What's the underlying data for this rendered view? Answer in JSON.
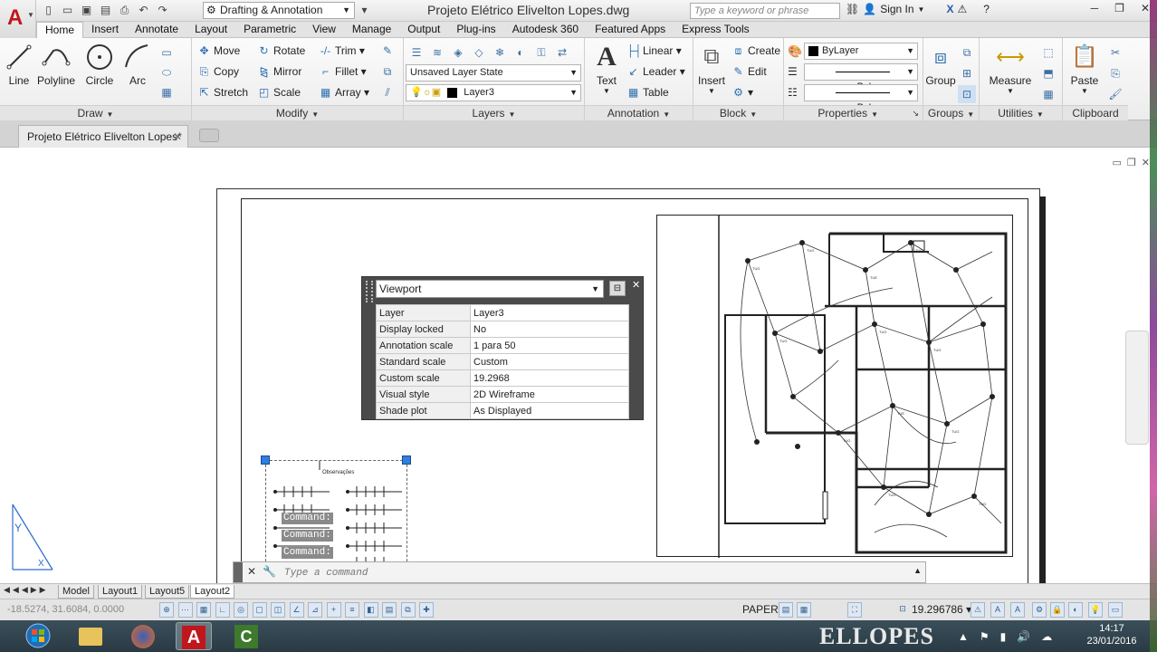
{
  "window": {
    "title": "Projeto Elétrico Elivelton Lopes.dwg",
    "workspace": "Drafting & Annotation",
    "search_placeholder": "Type a keyword or phrase",
    "sign_in": "Sign In"
  },
  "ribbon_tabs": [
    "Home",
    "Insert",
    "Annotate",
    "Layout",
    "Parametric",
    "View",
    "Manage",
    "Output",
    "Plug-ins",
    "Autodesk 360",
    "Featured Apps",
    "Express Tools"
  ],
  "panels": {
    "draw": {
      "title": "Draw",
      "line": "Line",
      "polyline": "Polyline",
      "circle": "Circle",
      "arc": "Arc"
    },
    "modify": {
      "title": "Modify",
      "move": "Move",
      "rotate": "Rotate",
      "trim": "Trim",
      "copy": "Copy",
      "mirror": "Mirror",
      "fillet": "Fillet",
      "stretch": "Stretch",
      "scale": "Scale",
      "array": "Array"
    },
    "layers": {
      "title": "Layers",
      "layer_state": "Unsaved Layer State",
      "current_layer": "Layer3"
    },
    "annotation": {
      "title": "Annotation",
      "text": "Text",
      "linear": "Linear",
      "leader": "Leader",
      "table": "Table"
    },
    "block": {
      "title": "Block",
      "insert": "Insert",
      "create": "Create",
      "edit": "Edit"
    },
    "properties": {
      "title": "Properties",
      "color": "ByLayer",
      "linetype": "ByLayer",
      "lineweight": "ByLayer"
    },
    "groups": {
      "title": "Groups",
      "group": "Group"
    },
    "utilities": {
      "title": "Utilities",
      "measure": "Measure"
    },
    "clipboard": {
      "title": "Clipboard",
      "paste": "Paste"
    }
  },
  "doc_tab": "Projeto Elétrico Elivelton Lopes*",
  "quick_properties": {
    "object_type": "Viewport",
    "rows": [
      {
        "label": "Layer",
        "value": "Layer3"
      },
      {
        "label": "Display locked",
        "value": "No"
      },
      {
        "label": "Annotation scale",
        "value": "1 para 50"
      },
      {
        "label": "Standard scale",
        "value": "Custom"
      },
      {
        "label": "Custom scale",
        "value": "19.2968"
      },
      {
        "label": "Visual style",
        "value": "2D Wireframe"
      },
      {
        "label": "Shade plot",
        "value": "As Displayed"
      }
    ]
  },
  "legend_title": "Observações",
  "command_history": [
    "Command:",
    "Command:",
    "Command:"
  ],
  "command_placeholder": "Type a command",
  "layout_tabs": [
    "Model",
    "Layout1",
    "Layout5",
    "Layout2"
  ],
  "active_layout": "Layout2",
  "status": {
    "coords": "-18.5274, 31.6084, 0.0000",
    "space": "PAPER",
    "viewport_scale": "19.296786"
  },
  "taskbar": {
    "brand": "ELLOPES",
    "time": "14:17",
    "date": "23/01/2016"
  },
  "colors": {
    "accent": "#c0161d",
    "grip": "#2f7fe0",
    "quickprops_bg": "#4a4a4a"
  }
}
